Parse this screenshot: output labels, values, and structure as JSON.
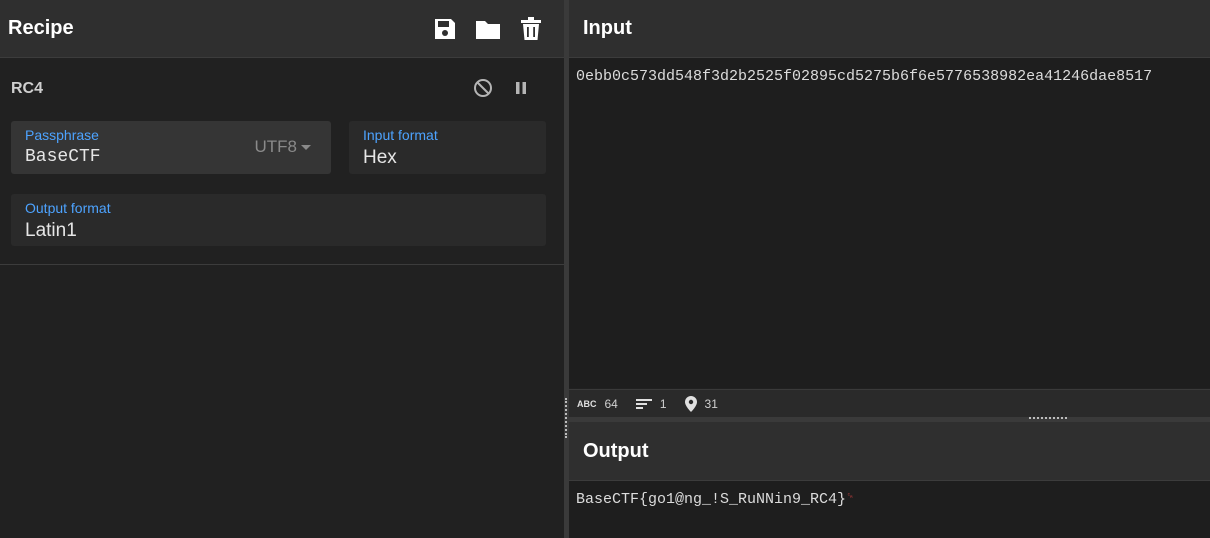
{
  "recipe": {
    "title": "Recipe",
    "icons": [
      "save-icon",
      "folder-icon",
      "trash-icon"
    ]
  },
  "operation": {
    "name": "RC4",
    "passphrase": {
      "label": "Passphrase",
      "value": "BaseCTF",
      "encoding": "UTF8"
    },
    "input_format": {
      "label": "Input format",
      "value": "Hex"
    },
    "output_format": {
      "label": "Output format",
      "value": "Latin1"
    }
  },
  "input": {
    "title": "Input",
    "text": "0ebb0c573dd548f3d2b2525f02895cd5275b6f6e5776538982ea41246dae8517"
  },
  "status": {
    "length_icon": "ABC",
    "length": "64",
    "lines": "1",
    "position": "31"
  },
  "output": {
    "title": "Output",
    "text": "BaseCTF{go1@ng_!S_RuNNin9_RC4}",
    "trailing_mark": "␍"
  },
  "colors": {
    "accent": "#4da3ff",
    "background": "#212121",
    "header": "#2f2f2f"
  }
}
